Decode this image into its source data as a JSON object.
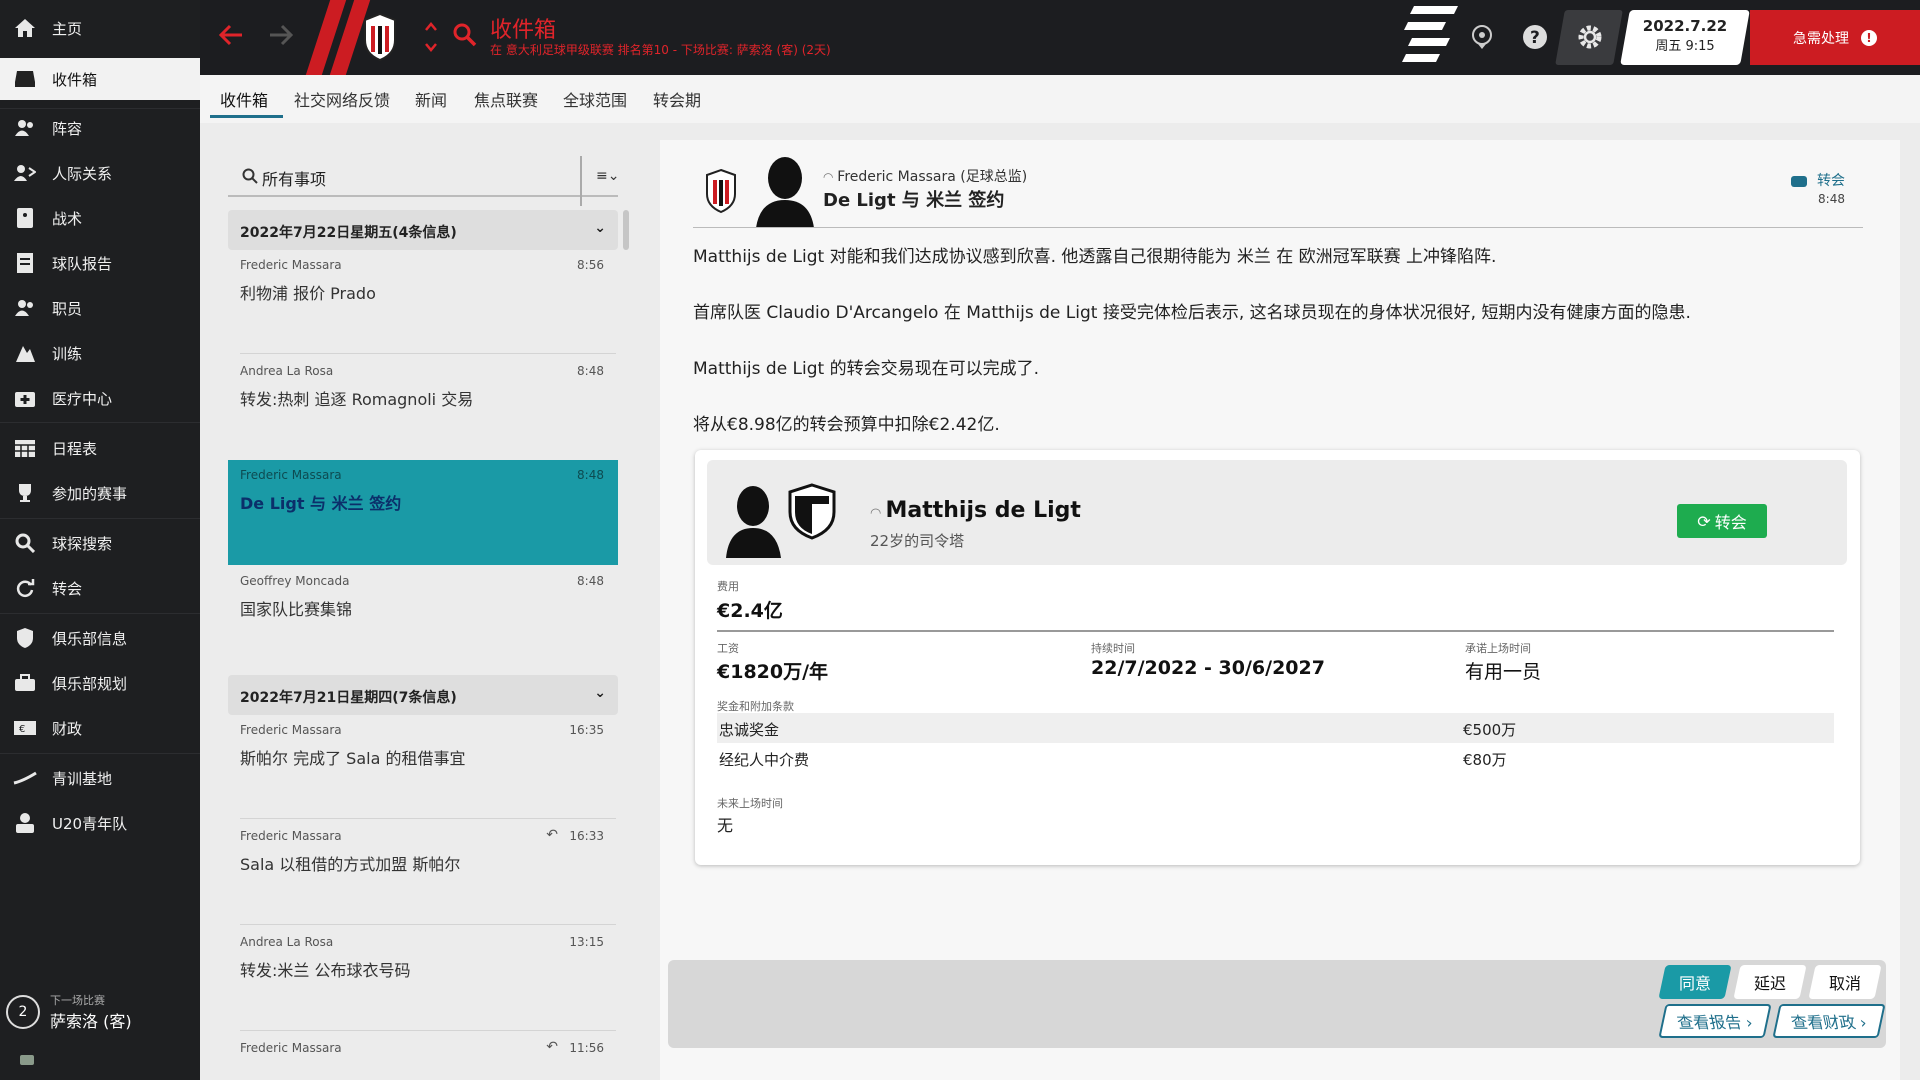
{
  "sidebar": {
    "items": [
      {
        "label": "主页",
        "icon": "home-icon"
      },
      {
        "label": "收件箱",
        "icon": "inbox-icon"
      },
      {
        "label": "阵容",
        "icon": "squad-icon"
      },
      {
        "label": "人际关系",
        "icon": "relations-icon"
      },
      {
        "label": "战术",
        "icon": "tactics-icon"
      },
      {
        "label": "球队报告",
        "icon": "report-icon"
      },
      {
        "label": "职员",
        "icon": "staff-icon"
      },
      {
        "label": "训练",
        "icon": "training-icon"
      },
      {
        "label": "医疗中心",
        "icon": "medical-icon"
      },
      {
        "label": "日程表",
        "icon": "calendar-icon"
      },
      {
        "label": "参加的赛事",
        "icon": "trophy-icon"
      },
      {
        "label": "球探搜索",
        "icon": "scouting-icon"
      },
      {
        "label": "转会",
        "icon": "transfer-icon"
      },
      {
        "label": "俱乐部信息",
        "icon": "shield-icon"
      },
      {
        "label": "俱乐部规划",
        "icon": "briefcase-icon"
      },
      {
        "label": "财政",
        "icon": "finance-icon"
      },
      {
        "label": "青训基地",
        "icon": "youth-icon"
      },
      {
        "label": "U20青年队",
        "icon": "u20-icon"
      }
    ],
    "active_index": 1,
    "next_match": {
      "label": "下一场比赛",
      "number": "2",
      "opponent": "萨索洛 (客)"
    }
  },
  "topbar": {
    "title": "收件箱",
    "subtitle": "在 意大利足球甲级联赛 排名第10 - 下场比赛: 萨索洛 (客) (2天)",
    "date": "2022.7.22",
    "weekday": "周五 9:15",
    "urgent": "急需处理"
  },
  "tabs": [
    "收件箱",
    "社交网络反馈",
    "新闻",
    "焦点联赛",
    "全球范围",
    "转会期"
  ],
  "list": {
    "filter": "所有事项",
    "groups": [
      {
        "header": "2022年7月22日星期五(4条信息)"
      },
      {
        "header": "2022年7月21日星期四(7条信息)"
      }
    ],
    "messages": [
      {
        "from": "Frederic Massara",
        "time": "8:56",
        "subject": "利物浦 报价 Prado"
      },
      {
        "from": "Andrea La Rosa",
        "time": "8:48",
        "subject": "转发:热刺 追逐 Romagnoli 交易"
      },
      {
        "from": "Frederic Massara",
        "time": "8:48",
        "subject": "De Ligt 与 米兰 签约"
      },
      {
        "from": "Geoffrey Moncada",
        "time": "8:48",
        "subject": "国家队比赛集锦"
      },
      {
        "from": "Frederic Massara",
        "time": "16:35",
        "subject": "斯帕尔 完成了 Sala 的租借事宜"
      },
      {
        "from": "Frederic Massara",
        "time": "16:33",
        "subject": "Sala 以租借的方式加盟 斯帕尔"
      },
      {
        "from": "Andrea La Rosa",
        "time": "13:15",
        "subject": "转发:米兰 公布球衣号码"
      },
      {
        "from": "Frederic Massara",
        "time": "11:56",
        "subject": ""
      }
    ]
  },
  "detail": {
    "from": "Frederic Massara (足球总监)",
    "subject": "De Ligt 与 米兰 签约",
    "tag": "转会",
    "time": "8:48",
    "p1": "Matthijs de Ligt 对能和我们达成协议感到欣喜. 他透露自己很期待能为 米兰 在 欧洲冠军联赛 上冲锋陷阵.",
    "p2": "首席队医 Claudio D'Arcangelo 在 Matthijs de Ligt 接受完体检后表示, 这名球员现在的身体状况很好, 短期内没有健康方面的隐患.",
    "p3": "Matthijs de Ligt 的转会交易现在可以完成了.",
    "p4": "将从€8.98亿的转会预算中扣除€2.42亿.",
    "card": {
      "player": "Matthijs de Ligt",
      "desc": "22岁的司令塔",
      "button": "转会",
      "fee_label": "费用",
      "fee": "€2.4亿",
      "wage_label": "工资",
      "wage": "€1820万/年",
      "duration_label": "持续时间",
      "duration": "22/7/2022 - 30/6/2027",
      "promise_label": "承诺上场时间",
      "promise": "有用一员",
      "bonus_label": "奖金和附加条款",
      "bonuses": [
        {
          "name": "忠诚奖金",
          "value": "€500万"
        },
        {
          "name": "经纪人中介费",
          "value": "€80万"
        }
      ],
      "future_label": "未来上场时间",
      "future": "无"
    },
    "buttons": {
      "agree": "同意",
      "delay": "延迟",
      "cancel": "取消",
      "view_report": "查看报告",
      "view_finance": "查看财政"
    }
  },
  "colors": {
    "accent": "#1a9aa6",
    "brand_red": "#cc1c22",
    "green": "#1eac4f"
  }
}
